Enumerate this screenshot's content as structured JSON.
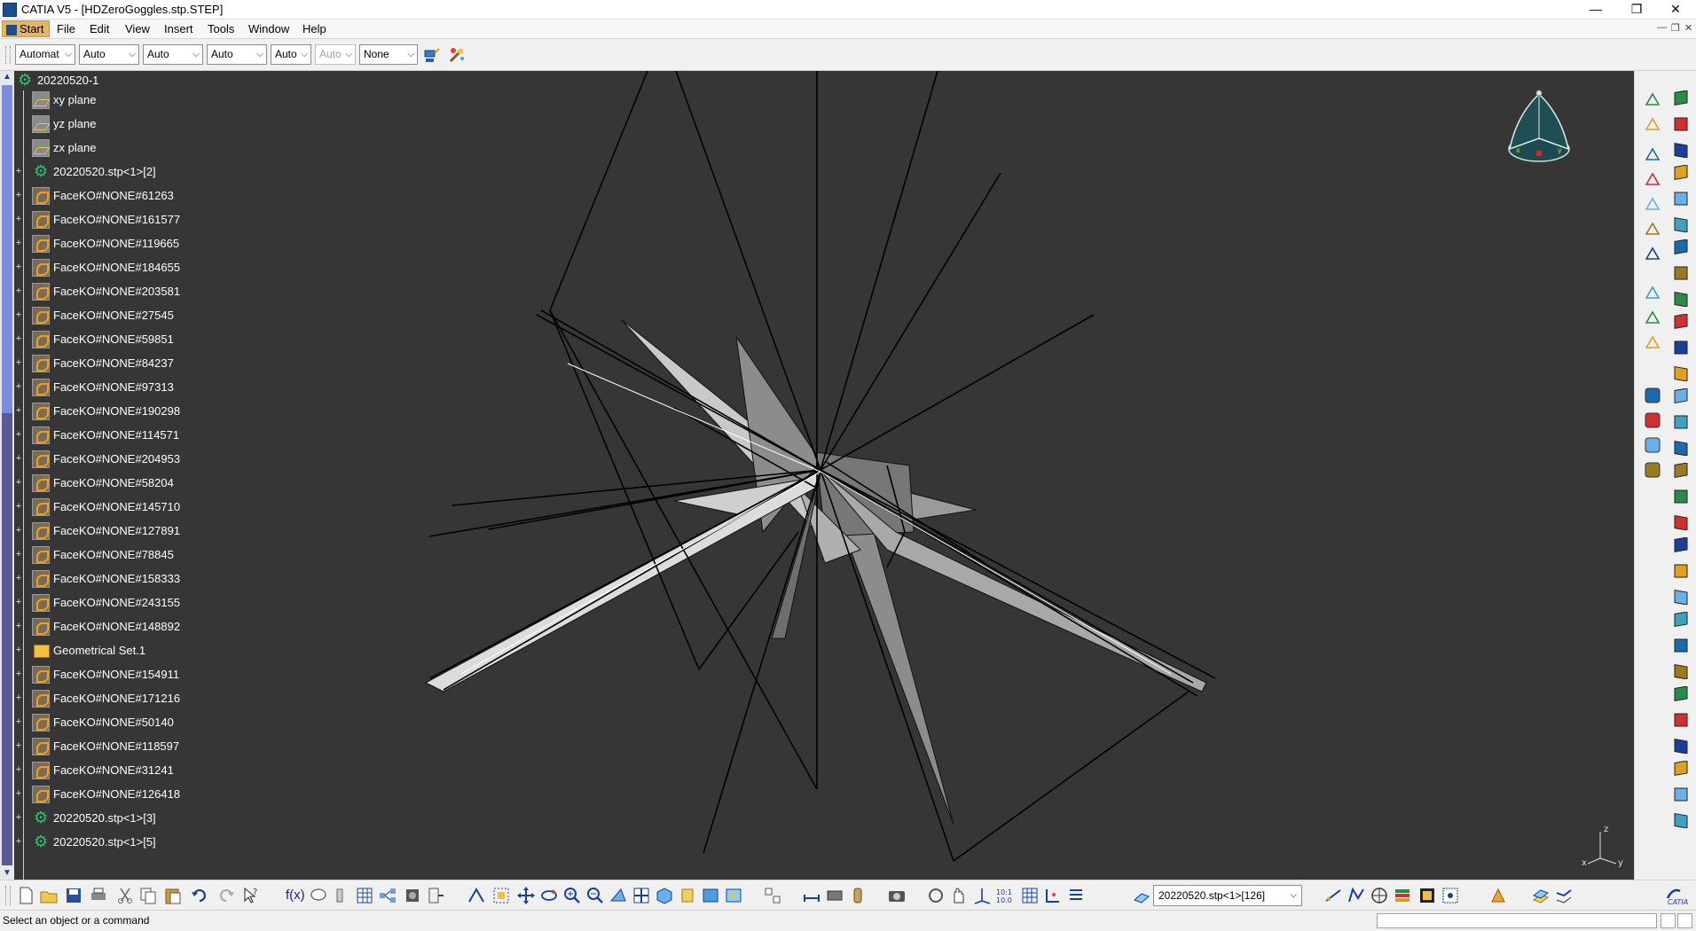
{
  "window": {
    "title": "CATIA V5 - [HDZeroGoggles.stp.STEP]",
    "minimize": "—",
    "maximize": "❐",
    "close": "✕",
    "mdi_minimize": "—",
    "mdi_restore": "❐",
    "mdi_close": "✕"
  },
  "menu": {
    "start": "Start",
    "items": [
      "File",
      "Edit",
      "View",
      "Insert",
      "Tools",
      "Window",
      "Help"
    ]
  },
  "graphic_properties": {
    "color": "Automat",
    "transparency": "Auto",
    "linetype": "Auto",
    "thickness": "Auto",
    "point_symbol": "Auto",
    "point_symbol_disabled": "Auto",
    "layer": "None",
    "painter_icon": "format-painter-icon",
    "wizard_icon": "graphic-properties-wizard-icon"
  },
  "tree": {
    "root": "20220520-1",
    "nodes": [
      {
        "label": "xy plane",
        "icon": "plane-icon",
        "expander": ""
      },
      {
        "label": "yz plane",
        "icon": "plane-icon",
        "expander": ""
      },
      {
        "label": "zx plane",
        "icon": "plane-icon",
        "expander": ""
      },
      {
        "label": "20220520.stp<1>[2]",
        "icon": "part-icon",
        "expander": "+"
      },
      {
        "label": "FaceKO#NONE#61263",
        "icon": "face-icon",
        "expander": "+"
      },
      {
        "label": "FaceKO#NONE#161577",
        "icon": "face-icon",
        "expander": "+"
      },
      {
        "label": "FaceKO#NONE#119665",
        "icon": "face-icon",
        "expander": "+"
      },
      {
        "label": "FaceKO#NONE#184655",
        "icon": "face-icon",
        "expander": "+"
      },
      {
        "label": "FaceKO#NONE#203581",
        "icon": "face-icon",
        "expander": "+"
      },
      {
        "label": "FaceKO#NONE#27545",
        "icon": "face-icon",
        "expander": "+"
      },
      {
        "label": "FaceKO#NONE#59851",
        "icon": "face-icon",
        "expander": "+"
      },
      {
        "label": "FaceKO#NONE#84237",
        "icon": "face-icon",
        "expander": "+"
      },
      {
        "label": "FaceKO#NONE#97313",
        "icon": "face-icon",
        "expander": "+"
      },
      {
        "label": "FaceKO#NONE#190298",
        "icon": "face-icon",
        "expander": "+"
      },
      {
        "label": "FaceKO#NONE#114571",
        "icon": "face-icon",
        "expander": "+"
      },
      {
        "label": "FaceKO#NONE#204953",
        "icon": "face-icon",
        "expander": "+"
      },
      {
        "label": "FaceKO#NONE#58204",
        "icon": "face-icon",
        "expander": "+"
      },
      {
        "label": "FaceKO#NONE#145710",
        "icon": "face-icon",
        "expander": "+"
      },
      {
        "label": "FaceKO#NONE#127891",
        "icon": "face-icon",
        "expander": "+"
      },
      {
        "label": "FaceKO#NONE#78845",
        "icon": "face-icon",
        "expander": "+"
      },
      {
        "label": "FaceKO#NONE#158333",
        "icon": "face-icon",
        "expander": "+"
      },
      {
        "label": "FaceKO#NONE#243155",
        "icon": "face-icon",
        "expander": "+"
      },
      {
        "label": "FaceKO#NONE#148892",
        "icon": "face-icon",
        "expander": "+"
      },
      {
        "label": "Geometrical Set.1",
        "icon": "geometrical-set-icon",
        "expander": "+"
      },
      {
        "label": "FaceKO#NONE#154911",
        "icon": "face-icon",
        "expander": "+"
      },
      {
        "label": "FaceKO#NONE#171216",
        "icon": "face-icon",
        "expander": "+"
      },
      {
        "label": "FaceKO#NONE#50140",
        "icon": "face-icon",
        "expander": "+"
      },
      {
        "label": "FaceKO#NONE#118597",
        "icon": "face-icon",
        "expander": "+"
      },
      {
        "label": "FaceKO#NONE#31241",
        "icon": "face-icon",
        "expander": "+"
      },
      {
        "label": "FaceKO#NONE#126418",
        "icon": "face-icon",
        "expander": "+"
      },
      {
        "label": "20220520.stp<1>[3]",
        "icon": "part-icon",
        "expander": "+"
      },
      {
        "label": "20220520.stp<1>[5]",
        "icon": "part-icon",
        "expander": "+"
      }
    ]
  },
  "viewport": {
    "background": "#363636",
    "compass_icon": "compass-icon",
    "axis_labels": {
      "z": "z",
      "x": "x",
      "y": "y"
    }
  },
  "bottom_toolbar": {
    "selection_combo": "20220520.stp<1>[126]"
  },
  "status": {
    "message": "Select an object or a command"
  },
  "colors": {
    "viewport_bg": "#363636",
    "tree_text": "#ffffff",
    "start_button": "#e3b567",
    "scroll_thumb": "#7a8be0"
  }
}
